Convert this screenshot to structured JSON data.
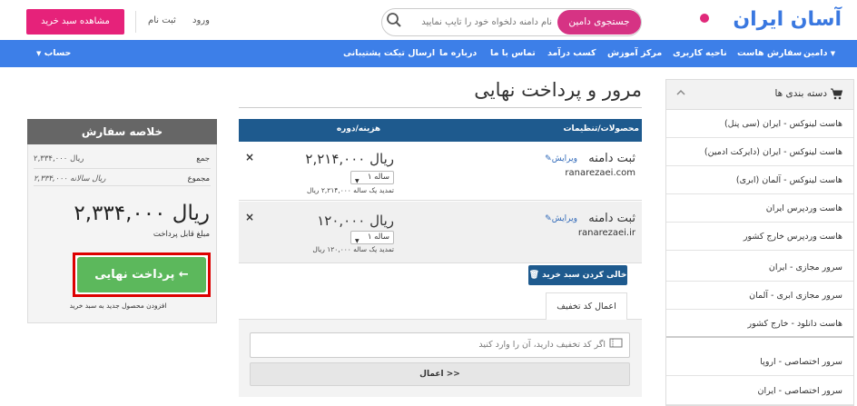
{
  "header": {
    "logo_text": "آسان ایران",
    "search_button": "جستجوی دامین",
    "search_placeholder": "نام دامنه دلخواه خود را تایپ نمایید",
    "login": "ورود",
    "register": "ثبت نام",
    "view_cart": "مشاهده سبد خرید"
  },
  "nav": {
    "items": [
      "دامین",
      "سفارش هاست",
      "ناحیه کاربری",
      "مرکز آموزش",
      "کسب درآمد",
      "تماس با ما",
      "درباره ما",
      "ارسال تیکت پشتیبانی"
    ],
    "account": "حساب"
  },
  "sidebar": {
    "title": "دسته بندی ها",
    "items": [
      "هاست لینوکس - ایران (سی پنل)",
      "هاست لینوکس - ایران (دایرکت ادمین)",
      "هاست لینوکس - آلمان (ابری)",
      "هاست وردپرس ایران",
      "هاست وردپرس خارج کشور",
      "سرور مجازی - ایران",
      "سرور مجازی ابری - آلمان",
      "هاست دانلود - خارج کشور",
      "سرور اختصاصی - اروپا",
      "سرور اختصاصی - ایران"
    ]
  },
  "page": {
    "title": "مرور و پرداخت نهایی"
  },
  "cart": {
    "col_products": "محصولات/تنظیمات",
    "col_price": "هزینه/دوره",
    "items": [
      {
        "name": "ثبت دامنه",
        "edit": "ویرایش",
        "domain": "ranarezaei.com",
        "price": "۲,۲۱۴,۰۰۰ ریال",
        "cycle": "۱ ساله",
        "renew": "تمدید یک ساله ۲,۲۱۴,۰۰۰ ریال",
        "remove": "×"
      },
      {
        "name": "ثبت دامنه",
        "edit": "ویرایش",
        "domain": "ranarezaei.ir",
        "price": "۱۲۰,۰۰۰ ریال",
        "cycle": "۱ ساله",
        "renew": "تمدید یک ساله ۱۲۰,۰۰۰ ریال",
        "remove": "×"
      }
    ],
    "empty_cart": "خالی کردن سبد خرید",
    "promo_tab": "اعمال کد تخفیف",
    "promo_placeholder": "اگر کد تخفیف دارید، آن را وارد کنید",
    "apply_button": "اعمال >>"
  },
  "summary": {
    "title": "خلاصه سفارش",
    "subtotal_label": "جمع",
    "subtotal_value": "۲,۳۳۴,۰۰۰ ریال",
    "total_label": "مجموع",
    "total_value": "۲,۳۳۴,۰۰۰ ریال سالانه",
    "total_big": "۲,۳۳۴,۰۰۰ ریال",
    "payable_label": "مبلغ قابل پرداخت",
    "checkout_button": "پرداخت نهایی ←",
    "add_more": "افزودن محصول جدید به سبد خرید"
  },
  "colors": {
    "nav": "#3d7fe8",
    "pink": "#e6227a",
    "table_header": "#1e5a8e",
    "checkout": "#5cb85c",
    "highlight": "#dd0000"
  }
}
